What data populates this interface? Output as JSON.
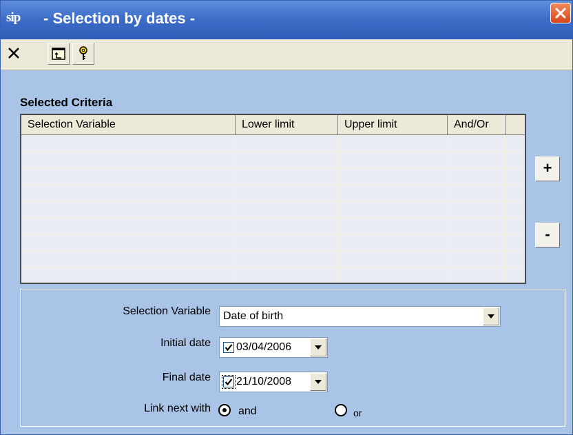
{
  "window": {
    "app_icon_text": "sip",
    "title": "- Selection by dates -"
  },
  "toolbar": {
    "buttons": [
      {
        "icon": "close-x-icon"
      },
      {
        "icon": "folder-up-icon"
      },
      {
        "icon": "help-key-icon"
      }
    ]
  },
  "criteria": {
    "section_title": "Selected Criteria",
    "columns": [
      "Selection Variable",
      "Lower limit",
      "Upper limit",
      "And/Or"
    ],
    "rows": [],
    "add_label": "+",
    "remove_label": "-"
  },
  "form": {
    "selection_variable_label": "Selection Variable",
    "selection_variable_value": "Date of birth",
    "initial_date_label": "Initial date",
    "initial_date_checked": true,
    "initial_date_value": "03/04/2006",
    "final_date_label": "Final date",
    "final_date_checked": true,
    "final_date_value": "21/10/2008",
    "link_label": "Link next with",
    "link_options": [
      {
        "label": "and",
        "selected": true
      },
      {
        "label": "or",
        "selected": false
      }
    ]
  },
  "colors": {
    "title_bar": "#2e5cb8",
    "window_bg": "#a9c4e6",
    "close_button": "#d9461c"
  }
}
